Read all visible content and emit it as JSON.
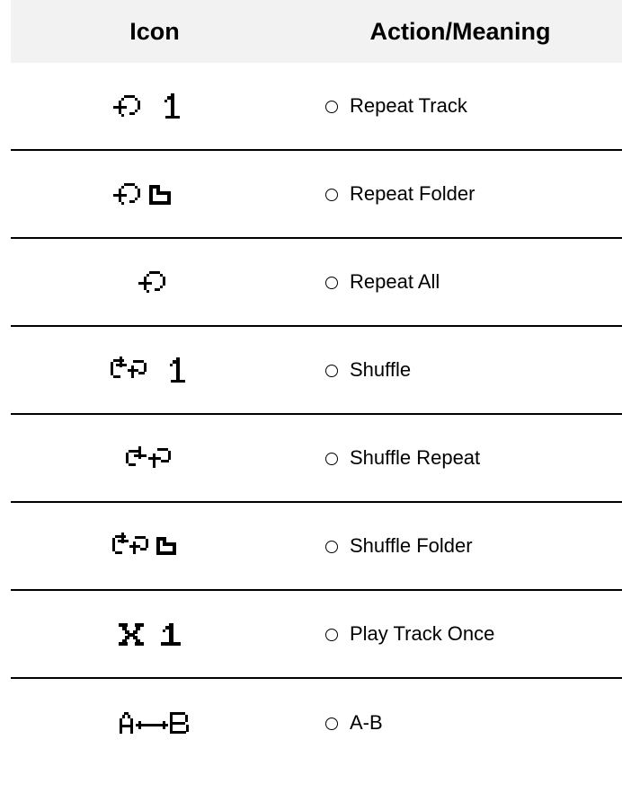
{
  "header": {
    "icon": "Icon",
    "action": "Action/Meaning"
  },
  "rows": [
    {
      "icon": "repeat-track-icon",
      "label": "Repeat Track"
    },
    {
      "icon": "repeat-folder-icon",
      "label": "Repeat Folder"
    },
    {
      "icon": "repeat-all-icon",
      "label": "Repeat All"
    },
    {
      "icon": "shuffle-icon",
      "label": "Shuffle"
    },
    {
      "icon": "shuffle-repeat-icon",
      "label": "Shuffle Repeat"
    },
    {
      "icon": "shuffle-folder-icon",
      "label": "Shuffle Folder"
    },
    {
      "icon": "play-track-once-icon",
      "label": "Play Track Once"
    },
    {
      "icon": "a-b-repeat-icon",
      "label": "A-B"
    }
  ]
}
